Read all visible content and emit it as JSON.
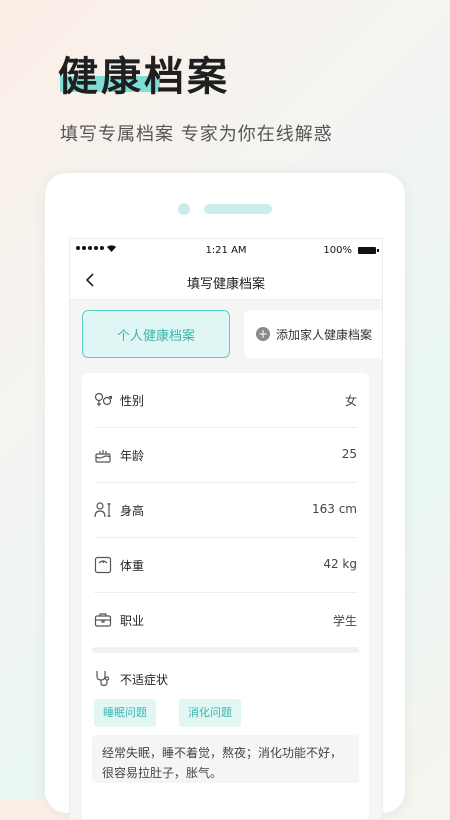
{
  "hero": {
    "title": "健康档案",
    "subtitle": "填写专属档案 专家为你在线解惑"
  },
  "status_bar": {
    "time": "1:21 AM",
    "battery": "100%"
  },
  "nav": {
    "title": "填写健康档案"
  },
  "tabs": {
    "personal_label": "个人健康档案",
    "family_label": "添加家人健康档案"
  },
  "fields": [
    {
      "icon": "gender-icon",
      "label": "性别",
      "value": "女"
    },
    {
      "icon": "cake-icon",
      "label": "年龄",
      "value": "25"
    },
    {
      "icon": "height-icon",
      "label": "身高",
      "value": "163 cm"
    },
    {
      "icon": "scale-icon",
      "label": "体重",
      "value": "42 kg"
    },
    {
      "icon": "briefcase-icon",
      "label": "职业",
      "value": "学生"
    }
  ],
  "symptoms": {
    "icon": "stethoscope-icon",
    "label": "不适症状",
    "tags": [
      "睡眠问题",
      "消化问题"
    ],
    "note": "经常失眠，睡不着觉，熬夜；消化功能不好，很容易拉肚子，胀气。"
  },
  "colors": {
    "accent": "#5fcfc6",
    "accent_text": "#3bb5ac",
    "accent_bg": "#dff6f4"
  }
}
